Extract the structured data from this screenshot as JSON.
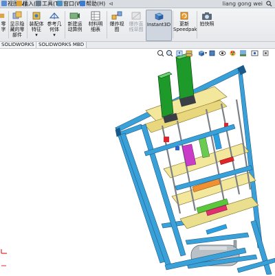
{
  "menu": {
    "items": [
      {
        "label": "视图(V)"
      },
      {
        "label": "插入(I)"
      },
      {
        "label": "工具(T)"
      },
      {
        "label": "窗口(W)"
      },
      {
        "label": "帮助(H)"
      }
    ],
    "user_name": "liang gong wei"
  },
  "ribbon": {
    "buttons": [
      {
        "label_1": "零",
        "label_2": "字",
        "label_3": ""
      },
      {
        "label_1": "显示隐",
        "label_2": "藏的零",
        "label_3": "部件"
      },
      {
        "label_1": "装配体",
        "label_2": "特征",
        "label_3": ""
      },
      {
        "label_1": "参考几",
        "label_2": "何体",
        "label_3": ""
      },
      {
        "label_1": "新建运",
        "label_2": "动算例",
        "label_3": ""
      },
      {
        "label_1": "材料明",
        "label_2": "细表",
        "label_3": ""
      },
      {
        "label_1": "爆炸视",
        "label_2": "图",
        "label_3": ""
      },
      {
        "label_1": "爆炸直",
        "label_2": "线草图",
        "label_3": ""
      },
      {
        "label_1": "Instant3D",
        "label_2": "",
        "label_3": ""
      },
      {
        "label_1": "更新",
        "label_2": "Speedpak",
        "label_3": ""
      },
      {
        "label_1": "拍快照",
        "label_2": "",
        "label_3": ""
      }
    ]
  },
  "tabs": [
    {
      "label": "SOLIDWORKS 插件"
    },
    {
      "label": "SOLIDWORKS MBD"
    }
  ],
  "colors": {
    "frame_blue": "#3aa0d8",
    "plate_yellow": "#f2e79a",
    "cylinder_green": "#1e9a2a",
    "tank_gray": "#b9c0c6",
    "background": "#ffffff",
    "accent_red": "#e0242c"
  },
  "icons": [
    "zoom-fit-icon",
    "zoom-area-icon",
    "previous-view-icon",
    "section-view-icon",
    "view-orientation-icon",
    "display-style-icon",
    "hide-show-icon",
    "edit-appearance-icon",
    "scene-icon",
    "view-settings-icon"
  ]
}
